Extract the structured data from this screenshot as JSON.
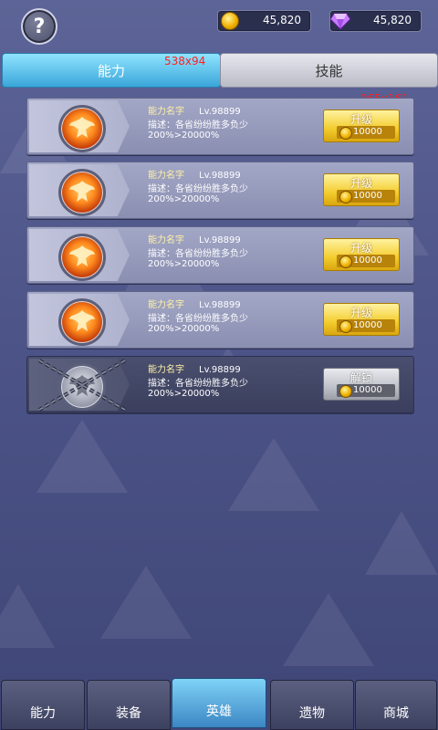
{
  "header": {
    "help_label": "?",
    "gold": "45,820",
    "diamond": "45,820"
  },
  "tabs": [
    {
      "label": "能力",
      "active": true
    },
    {
      "label": "技能",
      "active": false
    }
  ],
  "annotations": [
    "538x94",
    "965x161"
  ],
  "rows": [
    {
      "name": "能力名字",
      "level": "Lv.98899",
      "desc": "描述：各省纷纷胜多负少",
      "percent": "200%>20000%",
      "button": "升级",
      "cost": "10000",
      "locked": false
    },
    {
      "name": "能力名字",
      "level": "Lv.98899",
      "desc": "描述：各省纷纷胜多负少",
      "percent": "200%>20000%",
      "button": "升级",
      "cost": "10000",
      "locked": false
    },
    {
      "name": "能力名字",
      "level": "Lv.98899",
      "desc": "描述：各省纷纷胜多负少",
      "percent": "200%>20000%",
      "button": "升级",
      "cost": "10000",
      "locked": false
    },
    {
      "name": "能力名字",
      "level": "Lv.98899",
      "desc": "描述：各省纷纷胜多负少",
      "percent": "200%>20000%",
      "button": "升级",
      "cost": "10000",
      "locked": false
    },
    {
      "name": "能力名字",
      "level": "Lv.98899",
      "desc": "描述：各省纷纷胜多负少",
      "percent": "200%>20000%",
      "button": "解锁",
      "cost": "10000",
      "locked": true
    }
  ],
  "nav": [
    {
      "label": "能力",
      "active": false
    },
    {
      "label": "装备",
      "active": false
    },
    {
      "label": "英雄",
      "active": true
    },
    {
      "label": "遗物",
      "active": false
    },
    {
      "label": "商城",
      "active": false
    }
  ],
  "colors": {
    "tab_active": "#3aa6d9",
    "upgrade_button": "#f3cc2d",
    "unlock_button": "#bfc1c9",
    "annotation": "#ff2020"
  },
  "icons": [
    "help-icon",
    "gold-coin-icon",
    "diamond-icon",
    "phoenix-medal-icon",
    "locked-medal-icon",
    "chains-icon"
  ]
}
